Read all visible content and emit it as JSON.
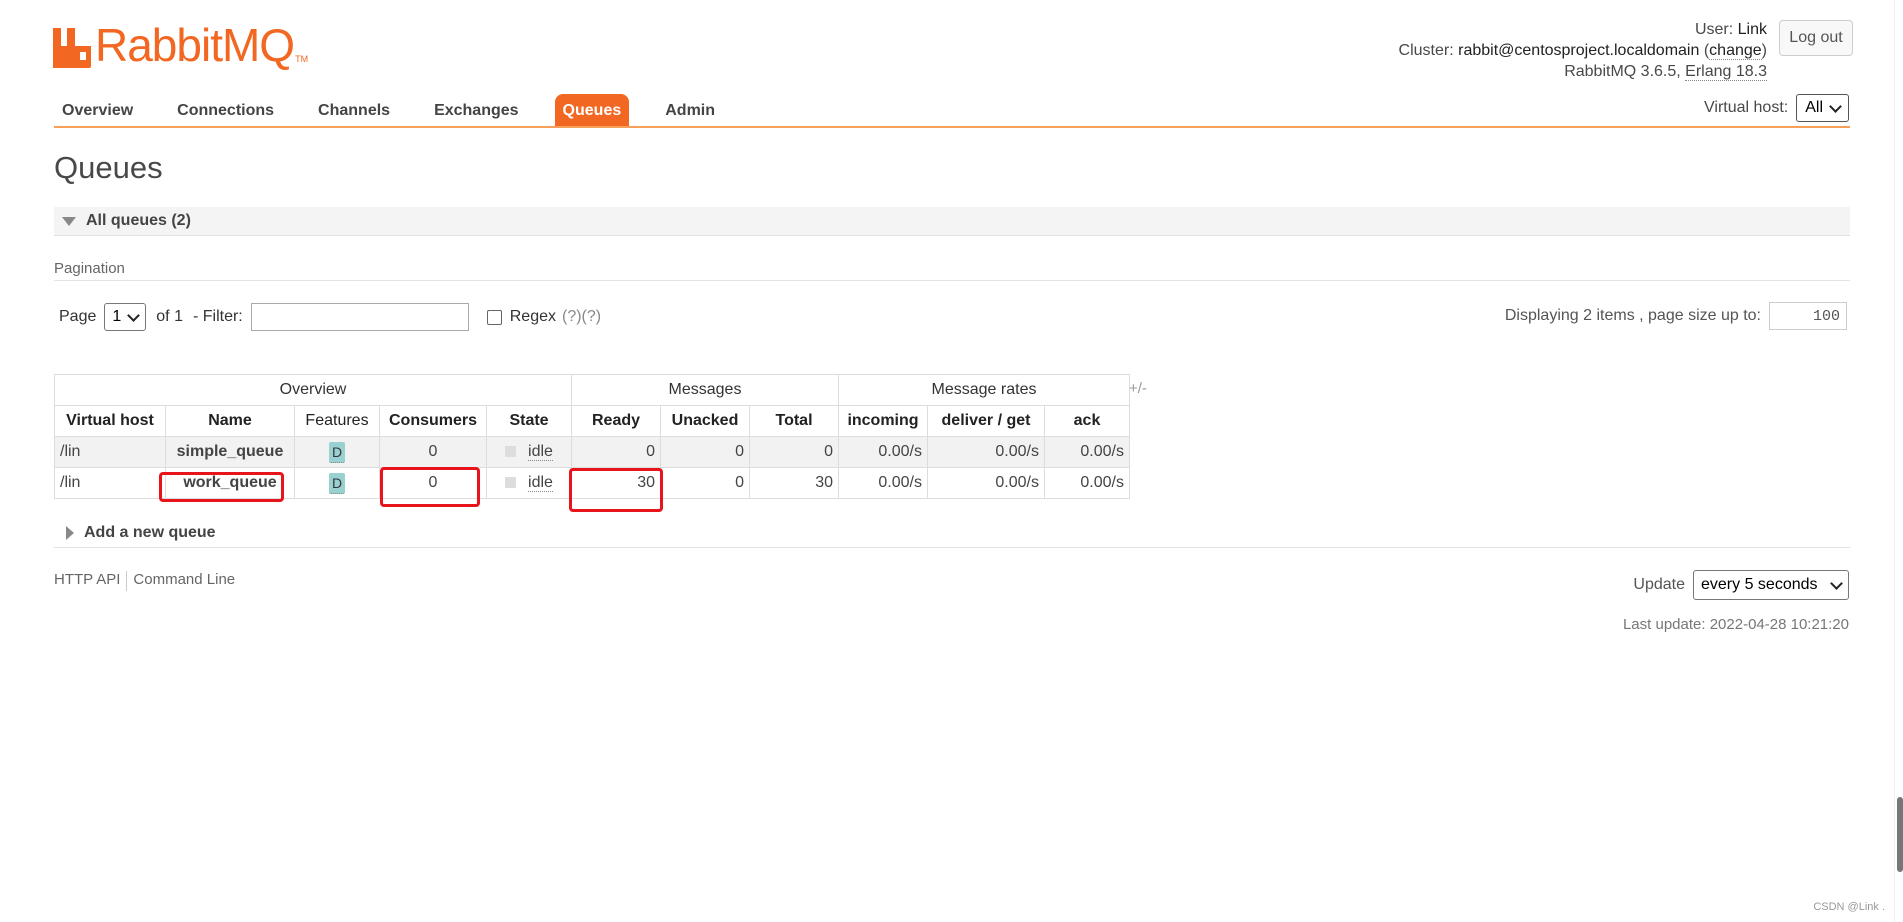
{
  "brand": {
    "name": "RabbitMQ",
    "trademark": "TM",
    "color": "#f26722"
  },
  "login": {
    "user_label": "User:",
    "user": "Link",
    "cluster_label": "Cluster:",
    "cluster": "rabbit@centosproject.localdomain",
    "change_label": "change",
    "version": "RabbitMQ 3.6.5,",
    "erlang": "Erlang 18.3",
    "logout_label": "Log out"
  },
  "tabs": [
    {
      "label": "Overview"
    },
    {
      "label": "Connections"
    },
    {
      "label": "Channels"
    },
    {
      "label": "Exchanges"
    },
    {
      "label": "Queues",
      "active": true
    },
    {
      "label": "Admin"
    }
  ],
  "vhost": {
    "label": "Virtual host:",
    "value": "All"
  },
  "page": {
    "title": "Queues"
  },
  "all_queues": {
    "label": "All queues (2)"
  },
  "pagination": {
    "section_label": "Pagination",
    "page_label": "Page",
    "page_value": "1",
    "of_label": "of 1",
    "filter_label": "- Filter:",
    "filter_value": "",
    "regex_label": "Regex",
    "regex_help": "(?)(?)",
    "display_label": "Displaying 2 items , page size up to:",
    "page_size": "100"
  },
  "table": {
    "groups": [
      "Overview",
      "Messages",
      "Message rates"
    ],
    "columns": [
      "Virtual host",
      "Name",
      "Features",
      "Consumers",
      "State",
      "Ready",
      "Unacked",
      "Total",
      "incoming",
      "deliver / get",
      "ack"
    ],
    "plus_minus": "+/-",
    "rows": [
      {
        "vhost": "/lin",
        "name": "simple_queue",
        "features": "D",
        "consumers": "0",
        "state": "idle",
        "ready": "0",
        "unacked": "0",
        "total": "0",
        "incoming": "0.00/s",
        "deliver": "0.00/s",
        "ack": "0.00/s"
      },
      {
        "vhost": "/lin",
        "name": "work_queue",
        "features": "D",
        "consumers": "0",
        "state": "idle",
        "ready": "30",
        "unacked": "0",
        "total": "30",
        "incoming": "0.00/s",
        "deliver": "0.00/s",
        "ack": "0.00/s"
      }
    ]
  },
  "add_queue": {
    "label": "Add a new queue"
  },
  "footer": {
    "http_api": "HTTP API",
    "command_line": "Command Line",
    "update_label": "Update",
    "update_value": "every 5 seconds",
    "last_update": "Last update: 2022-04-28 10:21:20"
  },
  "watermark": "CSDN @Link .",
  "highlight_color": "#e8141c"
}
